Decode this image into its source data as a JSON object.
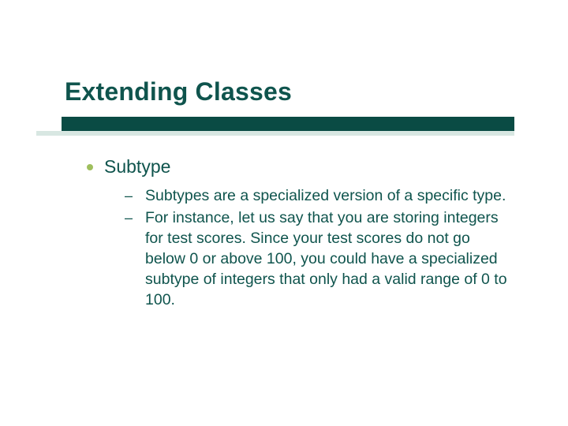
{
  "slide": {
    "title": "Extending Classes",
    "bullet": {
      "label": "Subtype",
      "subitems": [
        {
          "text": "Subtypes are a specialized version of a specific type."
        },
        {
          "text": "For instance, let us say that you are storing integers for test scores. Since your test scores do not go below 0 or above 100, you could have a specialized subtype of integers that only had a valid range of 0 to 100."
        }
      ]
    }
  },
  "colors": {
    "heading": "#0f544d",
    "accent_bullet": "#9fbf5d",
    "underline_dark": "#0a4b44",
    "underline_light": "#d8e7e2"
  }
}
